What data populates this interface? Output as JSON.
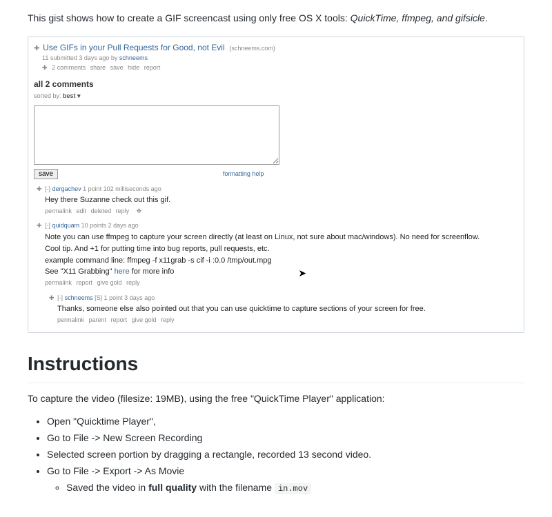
{
  "intro": {
    "pre": "This gist shows how to create a GIF screencast using only free OS X tools: ",
    "tools": "QuickTime, ffmpeg, and gifsicle",
    "post": "."
  },
  "reddit": {
    "title": "Use GIFs in your Pull Requests for Good, not Evil",
    "domain": "(schneems.com)",
    "submitted": "submitted 3 days ago by ",
    "author": "schneems",
    "score": "11",
    "actions": [
      "2 comments",
      "share",
      "save",
      "hide",
      "report"
    ],
    "all_comments": "all 2 comments",
    "sorted_by": "sorted by: ",
    "sort_mode": "best",
    "save_btn": "save",
    "formatting_help": "formatting help",
    "c1": {
      "collapse": "[-]",
      "user": "dergachev",
      "meta": "1 point 102 milliseconds ago",
      "body": "Hey there Suzanne check out this gif.",
      "acts": [
        "permalink",
        "edit",
        "deleted",
        "reply"
      ]
    },
    "c2": {
      "collapse": "[-]",
      "user": "quidquam",
      "meta": "10 points 2 days ago",
      "b1": "Note you can use ffmpeg to capture your screen directly (at least on Linux, not sure about mac/windows). No need for screenflow.",
      "b2": "Cool tip. And +1 for putting time into bug reports, pull requests, etc.",
      "b3": "example command line: ffmpeg -f x11grab -s cif -i :0.0 /tmp/out.mpg",
      "b4a": "See \"X11 Grabbing\" ",
      "b4link": "here",
      "b4b": " for more info",
      "acts": [
        "permalink",
        "report",
        "give gold",
        "reply"
      ]
    },
    "c3": {
      "collapse": "[-]",
      "user": "schneems",
      "badge": "[S]",
      "meta": "1 point 3 days ago",
      "body": "Thanks, someone else also pointed out that you can use quicktime to capture sections of your screen for free.",
      "acts": [
        "permalink",
        "parent",
        "report",
        "give gold",
        "reply"
      ]
    }
  },
  "instructions": {
    "heading": "Instructions",
    "p1": "To capture the video (filesize: 19MB), using the free \"QuickTime Player\" application:",
    "li1": "Open \"Quicktime Player\",",
    "li2": "Go to File -> New Screen Recording",
    "li3": "Selected screen portion by dragging a rectangle, recorded 13 second video.",
    "li4": "Go to File -> Export -> As Movie",
    "li5a": "Saved the video in ",
    "li5b": "full quality",
    "li5c": " with the filename ",
    "li5code": "in.mov"
  }
}
